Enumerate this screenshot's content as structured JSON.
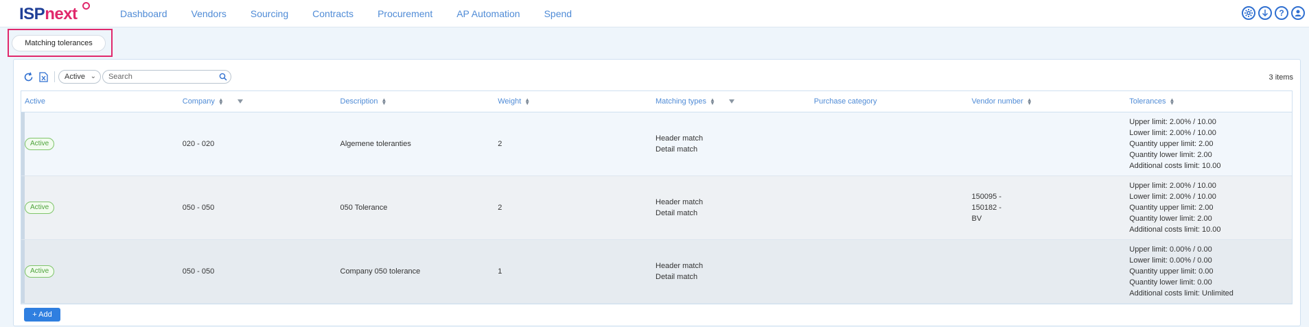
{
  "brand": {
    "part1": "ISP",
    "part2": "next"
  },
  "nav": [
    "Dashboard",
    "Vendors",
    "Sourcing",
    "Contracts",
    "Procurement",
    "AP Automation",
    "Spend"
  ],
  "top_icons": [
    "settings-icon",
    "download-icon",
    "help-icon",
    "user-icon"
  ],
  "tab": {
    "label": "Matching tolerances"
  },
  "toolbar": {
    "status_filter": "Active",
    "search_placeholder": "Search",
    "items_count": "3 items"
  },
  "table": {
    "headers": [
      "Active",
      "Company",
      "Description",
      "Weight",
      "Matching types",
      "Purchase category",
      "Vendor number",
      "Tolerances"
    ],
    "rows": [
      {
        "status": "Active",
        "company": "020 - 020",
        "description": "Algemene toleranties",
        "weight": "2",
        "matching_types": [
          "Header match",
          "Detail match"
        ],
        "purchase_category": "",
        "vendor_number": [
          "",
          "",
          ""
        ],
        "tolerances": [
          "Upper limit: 2.00% / 10.00",
          "Lower limit: 2.00% / 10.00",
          "Quantity upper limit: 2.00",
          "Quantity lower limit: 2.00",
          "Additional costs limit: 10.00"
        ]
      },
      {
        "status": "Active",
        "company": "050 - 050",
        "description": "050 Tolerance",
        "weight": "2",
        "matching_types": [
          "Header match",
          "Detail match"
        ],
        "purchase_category": "",
        "vendor_number": [
          "150095 -",
          "150182 -",
          "BV"
        ],
        "tolerances": [
          "Upper limit: 2.00% / 10.00",
          "Lower limit: 2.00% / 10.00",
          "Quantity upper limit: 2.00",
          "Quantity lower limit: 2.00",
          "Additional costs limit: 10.00"
        ]
      },
      {
        "status": "Active",
        "company": "050 - 050",
        "description": "Company 050 tolerance",
        "weight": "1",
        "matching_types": [
          "Header match",
          "Detail match"
        ],
        "purchase_category": "",
        "vendor_number": [
          "",
          "",
          ""
        ],
        "tolerances": [
          "Upper limit: 0.00% / 0.00",
          "Lower limit: 0.00% / 0.00",
          "Quantity upper limit: 0.00",
          "Quantity lower limit: 0.00",
          "Additional costs limit: Unlimited"
        ]
      }
    ]
  },
  "add_button": "+ Add",
  "colors": {
    "brand_blue": "#1f3f97",
    "brand_pink": "#e0286c",
    "link_blue": "#4f8bd6",
    "active_green": "#4ea33b",
    "button_blue": "#2f7fe0"
  }
}
